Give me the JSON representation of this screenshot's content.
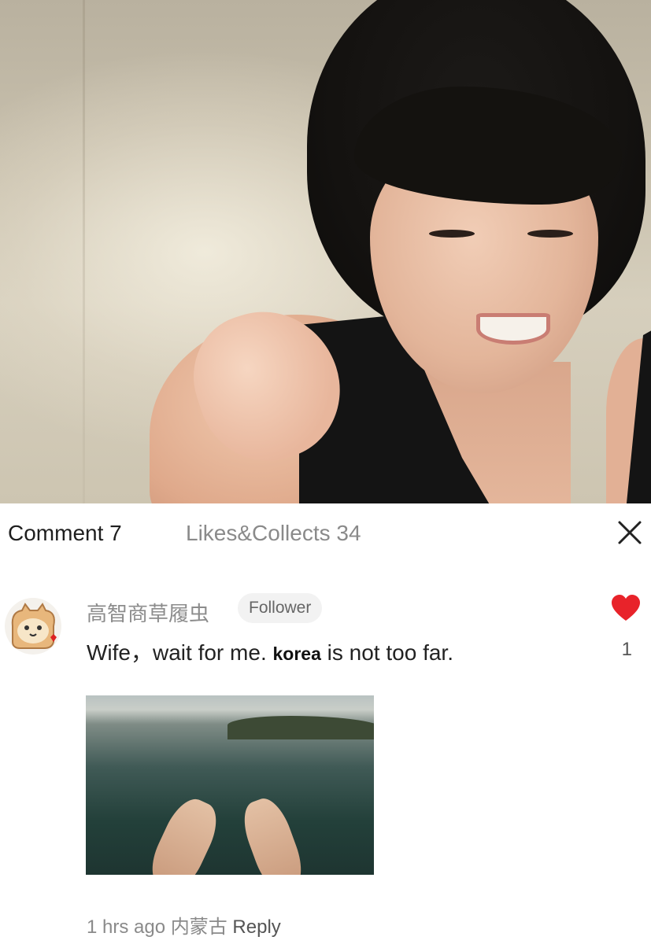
{
  "tabs": {
    "comment_label": "Comment 7",
    "likes_label": "Likes&Collects 34"
  },
  "comment": {
    "username": "高智商草履虫",
    "badge": "Follower",
    "text_before": "Wife，wait for me",
    "text_highlight": "korea",
    "text_after": "is not too far.",
    "like_count": "1",
    "time": "1 hrs ago",
    "location": "内蒙古",
    "reply_label": "Reply"
  },
  "colors": {
    "heart": "#e8232a",
    "muted_text": "#8a8a8a"
  },
  "icons": {
    "close": "close-icon",
    "like": "heart-icon"
  }
}
